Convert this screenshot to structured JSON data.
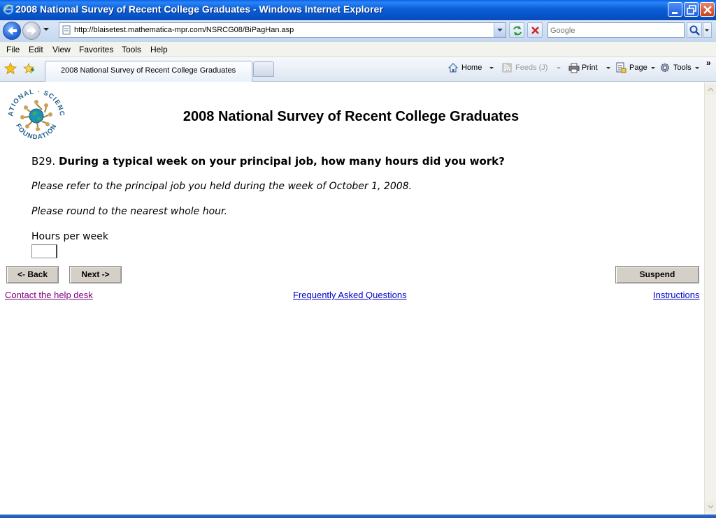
{
  "window": {
    "title": "2008 National Survey of Recent College Graduates - Windows Internet Explorer"
  },
  "address": {
    "url": "http://blaisetest.mathematica-mpr.com/NSRCG08/BiPagHan.asp",
    "search_placeholder": "Google"
  },
  "menu": {
    "items": [
      "File",
      "Edit",
      "View",
      "Favorites",
      "Tools",
      "Help"
    ]
  },
  "tabs": {
    "active_label": "2008 National Survey of Recent College Graduates"
  },
  "commands": {
    "home": "Home",
    "feeds": "Feeds (J)",
    "print": "Print",
    "page": "Page",
    "tools": "Tools",
    "overflow": "»"
  },
  "page": {
    "logo": {
      "top_text": "NATIONAL · SCIENCE",
      "bottom_text": "FOUNDATION"
    },
    "title": "2008 National Survey of Recent College Graduates",
    "question": {
      "number": "B29.",
      "text": "During a typical week on your principal job, how many hours did you work?"
    },
    "instruction_1": "Please refer to the principal job you held during the week of October 1, 2008.",
    "instruction_2": "Please round to the nearest whole hour.",
    "hours_label": "Hours per week",
    "hours_value": "",
    "buttons": {
      "back": "<- Back",
      "next": "Next ->",
      "suspend": "Suspend"
    },
    "links": {
      "help": "Contact the help desk",
      "faq": "Frequently Asked Questions",
      "instructions": "Instructions"
    }
  }
}
